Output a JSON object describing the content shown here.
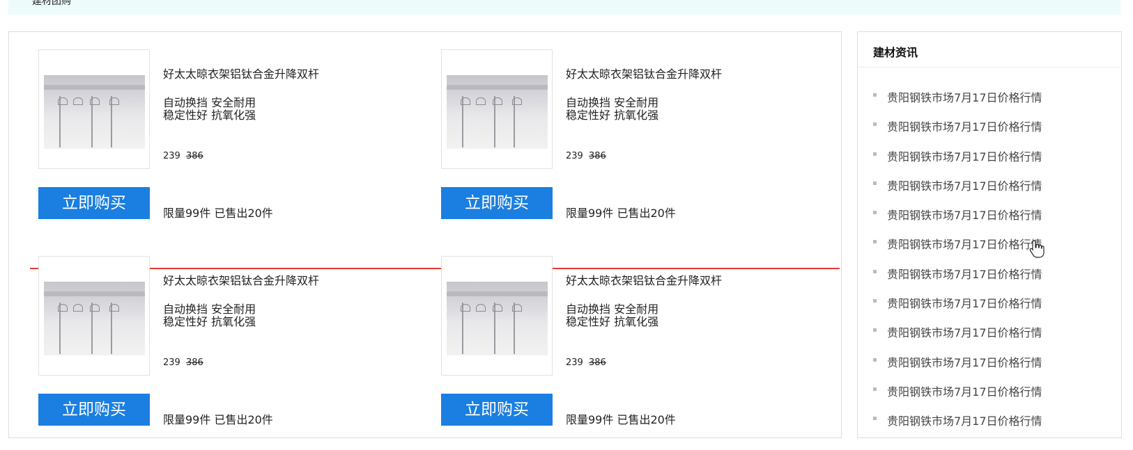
{
  "header": {
    "title": "建材团购"
  },
  "products": [
    {
      "title": "好太太晾衣架铝钛合金升降双杆",
      "features": [
        "自动换挡 安全耐用",
        "稳定性好 抗氧化强"
      ],
      "price": "239",
      "original_price": "386",
      "buy_label": "立即购买",
      "stock": "限量99件  已售出20件"
    },
    {
      "title": "好太太晾衣架铝钛合金升降双杆",
      "features": [
        "自动换挡 安全耐用",
        "稳定性好 抗氧化强"
      ],
      "price": "239",
      "original_price": "386",
      "buy_label": "立即购买",
      "stock": "限量99件  已售出20件"
    },
    {
      "title": "好太太晾衣架铝钛合金升降双杆",
      "features": [
        "自动换挡 安全耐用",
        "稳定性好 抗氧化强"
      ],
      "price": "239",
      "original_price": "386",
      "buy_label": "立即购买",
      "stock": "限量99件  已售出20件"
    },
    {
      "title": "好太太晾衣架铝钛合金升降双杆",
      "features": [
        "自动换挡 安全耐用",
        "稳定性好 抗氧化强"
      ],
      "price": "239",
      "original_price": "386",
      "buy_label": "立即购买",
      "stock": "限量99件  已售出20件"
    }
  ],
  "news": {
    "title": "建材资讯",
    "items": [
      "贵阳钢铁市场7月17日价格行情",
      "贵阳钢铁市场7月17日价格行情",
      "贵阳钢铁市场7月17日价格行情",
      "贵阳钢铁市场7月17日价格行情",
      "贵阳钢铁市场7月17日价格行情",
      "贵阳钢铁市场7月17日价格行情",
      "贵阳钢铁市场7月17日价格行情",
      "贵阳钢铁市场7月17日价格行情",
      "贵阳钢铁市场7月17日价格行情",
      "贵阳钢铁市场7月17日价格行情",
      "贵阳钢铁市场7月17日价格行情",
      "贵阳钢铁市场7月17日价格行情"
    ]
  },
  "colors": {
    "accent_blue": "#1a7fe0",
    "divider_red": "#e03a34",
    "topbar_bg": "#edfbfb"
  },
  "icons": {
    "cursor": "hand-pointer-icon"
  }
}
